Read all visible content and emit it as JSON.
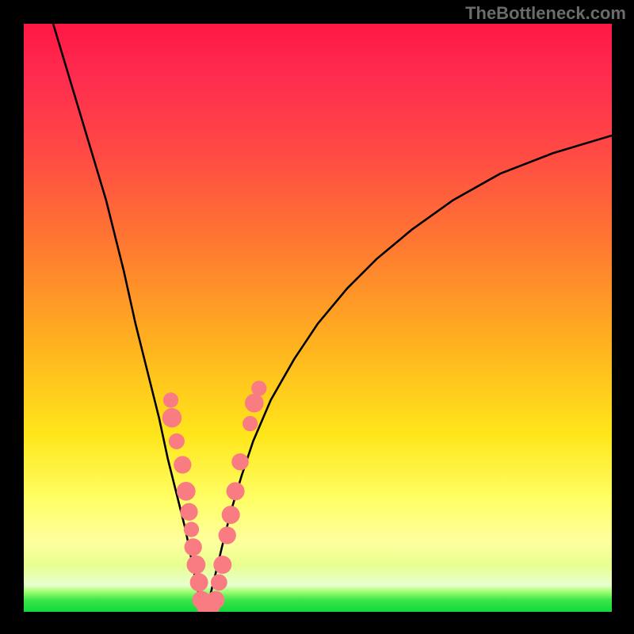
{
  "watermark": "TheBottleneck.com",
  "chart_data": {
    "type": "line",
    "title": "",
    "xlabel": "",
    "ylabel": "",
    "xlim": [
      0,
      100
    ],
    "ylim": [
      0,
      100
    ],
    "series": [
      {
        "name": "curve",
        "x": [
          5,
          8,
          11,
          14,
          17,
          19,
          21,
          23,
          24.5,
          26,
          27.5,
          28.5,
          29.3,
          30,
          30.7,
          31.5,
          32.5,
          33.7,
          35.2,
          37,
          39,
          42,
          46,
          50,
          55,
          60,
          66,
          73,
          81,
          90,
          100
        ],
        "y": [
          100,
          90,
          80,
          70,
          58,
          49,
          41,
          33,
          26,
          20,
          14,
          9,
          5,
          2,
          0.3,
          2,
          6,
          11,
          17,
          23,
          29,
          36,
          43,
          49,
          55,
          60,
          65,
          70,
          74.5,
          78,
          81
        ]
      }
    ],
    "markers": {
      "name": "highlighted-points",
      "color": "#f97c82",
      "points": [
        {
          "x": 25.0,
          "y": 36.0,
          "r": 1.3
        },
        {
          "x": 25.2,
          "y": 33.0,
          "r": 1.65
        },
        {
          "x": 26.0,
          "y": 29.0,
          "r": 1.35
        },
        {
          "x": 27.0,
          "y": 25.0,
          "r": 1.5
        },
        {
          "x": 27.6,
          "y": 20.5,
          "r": 1.6
        },
        {
          "x": 28.1,
          "y": 17.0,
          "r": 1.5
        },
        {
          "x": 28.5,
          "y": 14.0,
          "r": 1.3
        },
        {
          "x": 28.8,
          "y": 11.0,
          "r": 1.5
        },
        {
          "x": 29.3,
          "y": 8.0,
          "r": 1.6
        },
        {
          "x": 29.8,
          "y": 5.0,
          "r": 1.55
        },
        {
          "x": 30.2,
          "y": 2.0,
          "r": 1.55
        },
        {
          "x": 31.0,
          "y": 0.8,
          "r": 1.55
        },
        {
          "x": 31.8,
          "y": 0.8,
          "r": 1.5
        },
        {
          "x": 32.6,
          "y": 2.0,
          "r": 1.55
        },
        {
          "x": 33.2,
          "y": 5.0,
          "r": 1.4
        },
        {
          "x": 33.8,
          "y": 8.0,
          "r": 1.55
        },
        {
          "x": 34.6,
          "y": 13.0,
          "r": 1.5
        },
        {
          "x": 35.2,
          "y": 16.5,
          "r": 1.55
        },
        {
          "x": 36.0,
          "y": 20.5,
          "r": 1.55
        },
        {
          "x": 36.8,
          "y": 25.5,
          "r": 1.45
        },
        {
          "x": 38.5,
          "y": 32.0,
          "r": 1.3
        },
        {
          "x": 39.2,
          "y": 35.5,
          "r": 1.6
        },
        {
          "x": 40.0,
          "y": 38.0,
          "r": 1.3
        }
      ]
    }
  }
}
